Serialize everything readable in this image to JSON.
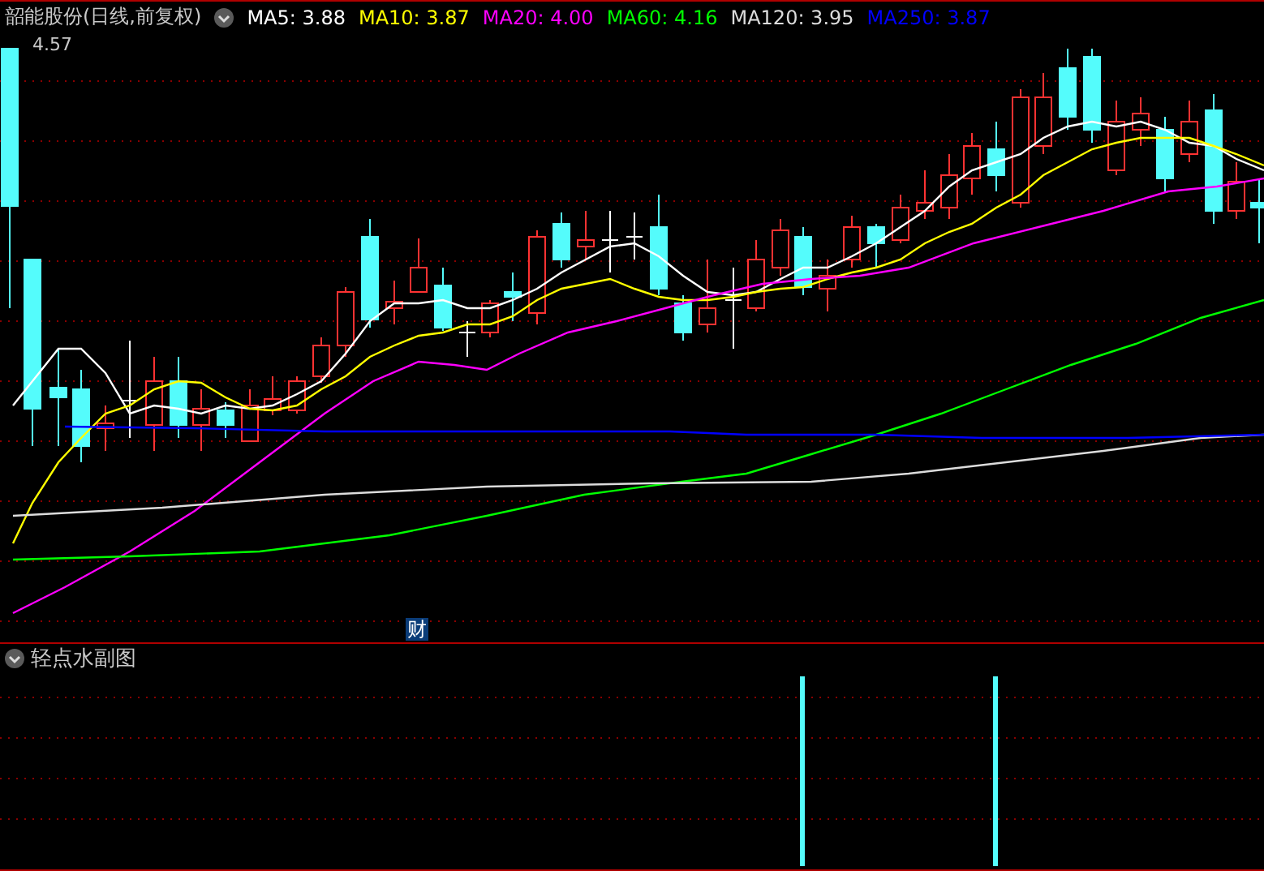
{
  "header": {
    "title": "韶能股份(日线,前复权)",
    "ma_legend": [
      {
        "label": "MA5: 3.88",
        "color": "#ffffff"
      },
      {
        "label": "MA10: 3.87",
        "color": "#ffff00"
      },
      {
        "label": "MA20: 4.00",
        "color": "#ff00ff"
      },
      {
        "label": "MA60: 4.16",
        "color": "#00ff00"
      },
      {
        "label": "MA120: 3.95",
        "color": "#dcdcdc"
      },
      {
        "label": "MA250: 3.87",
        "color": "#0000ff"
      }
    ]
  },
  "main_chart": {
    "high_price_label": "4.57",
    "event_marker": "财"
  },
  "sub_chart": {
    "title": "轻点水副图"
  }
}
